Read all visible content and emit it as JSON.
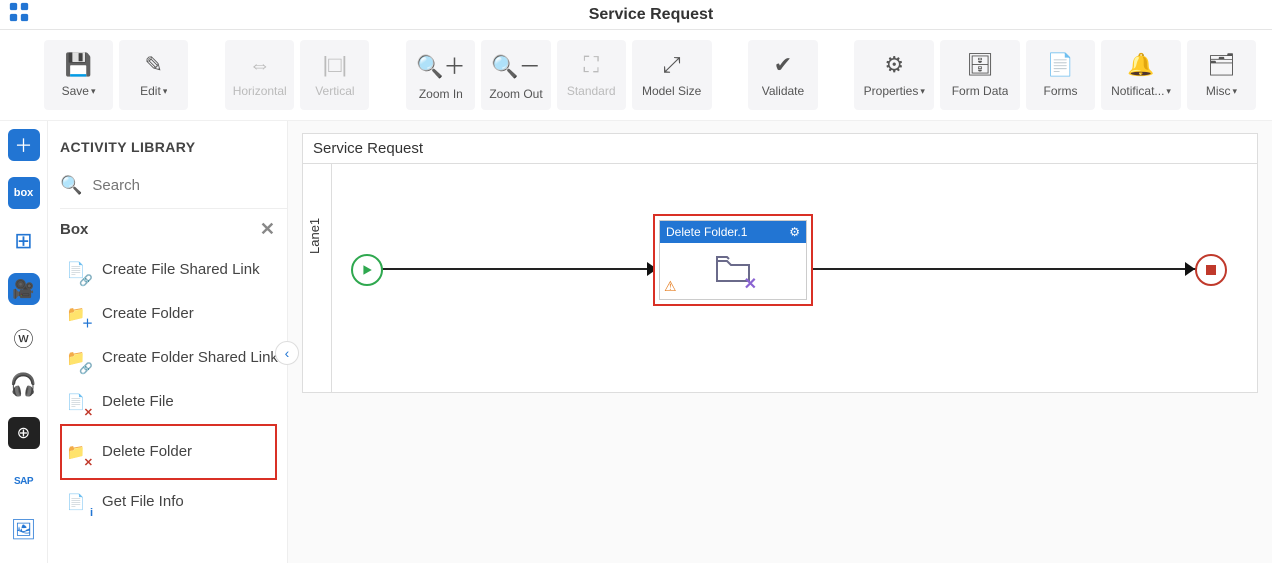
{
  "header": {
    "title": "Service Request"
  },
  "toolbar": {
    "save": "Save",
    "edit": "Edit",
    "horizontal": "Horizontal",
    "vertical": "Vertical",
    "zoom_in": "Zoom In",
    "zoom_out": "Zoom Out",
    "standard": "Standard",
    "model_size": "Model Size",
    "validate": "Validate",
    "properties": "Properties",
    "form_data": "Form Data",
    "forms": "Forms",
    "notifications": "Notificat...",
    "misc": "Misc"
  },
  "sidebar": {
    "title": "ACTIVITY LIBRARY",
    "search_placeholder": "Search",
    "group": "Box",
    "items": [
      {
        "label": "Create File Shared Link"
      },
      {
        "label": "Create Folder"
      },
      {
        "label": "Create Folder Shared Link"
      },
      {
        "label": "Delete File"
      },
      {
        "label": "Delete Folder"
      },
      {
        "label": "Get File Info"
      }
    ]
  },
  "canvas": {
    "title": "Service Request",
    "lane": "Lane1",
    "node_title": "Delete Folder.1"
  }
}
